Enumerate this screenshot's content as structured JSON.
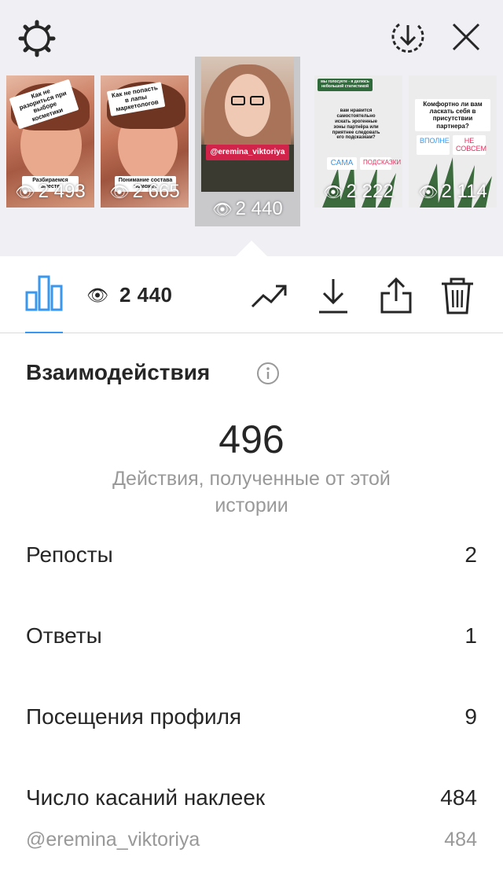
{
  "header": {
    "settings_icon": "gear-icon",
    "download_icon": "download-circle-icon",
    "close_icon": "close-icon"
  },
  "stories": [
    {
      "views": "2 493",
      "sticker_top": "Как не разориться при выборе косметики",
      "sticker_bottom": "Разбираемся вместе"
    },
    {
      "views": "2 665",
      "sticker_top": "Как не попасть в лапы маркетологов",
      "sticker_bottom": "Понимание состава поможет"
    },
    {
      "views": "2 440",
      "tag": "@eremina_viktoriya",
      "selected": true
    },
    {
      "views": "2 222",
      "poll_question": "вам нравится самостоятельно искать эрогенные зоны партнёра или приятнее следовать его подсказкам?",
      "header_text": "мы голосуете - я делюсь небольшой статистикой",
      "option_a": "САМА",
      "option_b": "ПОДСКАЗКИ"
    },
    {
      "views": "2 114",
      "poll_question": "Комфортно ли вам ласкать себя в присутствии партнера?",
      "option_a": "ВПОЛНЕ",
      "option_b": "НЕ СОВСЕМ"
    }
  ],
  "toolbar": {
    "views_count": "2 440",
    "insights_icon": "bar-chart-icon",
    "trend_icon": "trend-up-icon",
    "download_icon": "download-icon",
    "share_icon": "share-icon",
    "delete_icon": "trash-icon"
  },
  "interactions": {
    "title": "Взаимодействия",
    "total": "496",
    "description": "Действия, полученные от этой истории",
    "rows": [
      {
        "label": "Репосты",
        "value": "2"
      },
      {
        "label": "Ответы",
        "value": "1"
      },
      {
        "label": "Посещения профиля",
        "value": "9"
      },
      {
        "label": "Число касаний наклеек",
        "value": "484"
      }
    ],
    "sub_row": {
      "label": "@eremina_viktoriya",
      "value": "484"
    }
  },
  "colors": {
    "accent": "#3897f0",
    "top_bg": "#efeff4",
    "muted": "#999999"
  }
}
